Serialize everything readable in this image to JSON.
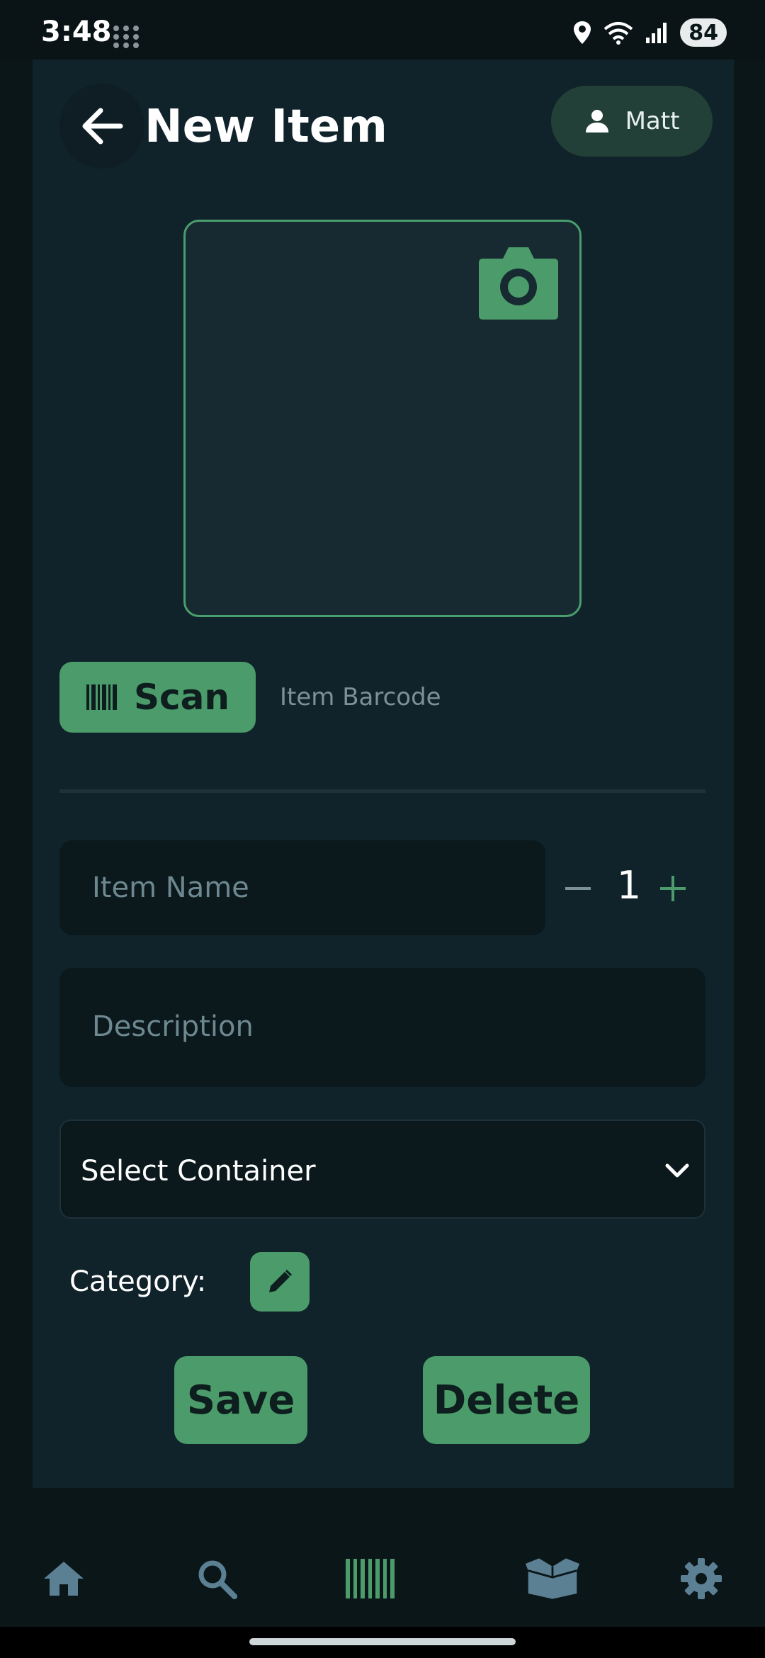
{
  "status_bar": {
    "time": "3:48",
    "battery": "84"
  },
  "header": {
    "title": "New Item",
    "user_name": "Matt"
  },
  "photo": {
    "camera_icon": "camera-icon"
  },
  "barcode": {
    "scan_label": "Scan",
    "barcode_label": "Item Barcode"
  },
  "form": {
    "name_placeholder": "Item Name",
    "quantity": "1",
    "description_placeholder": "Description",
    "container_value": "Select Container",
    "category_label": "Category:"
  },
  "actions": {
    "save_label": "Save",
    "delete_label": "Delete"
  },
  "nav": {
    "items": [
      {
        "icon": "home-icon"
      },
      {
        "icon": "search-icon"
      },
      {
        "icon": "barcode-icon"
      },
      {
        "icon": "box-icon"
      },
      {
        "icon": "gear-icon"
      }
    ]
  },
  "colors": {
    "accent": "#4b9c6a",
    "panel": "#10232a",
    "background": "#0b1619",
    "field": "#0b181c"
  }
}
